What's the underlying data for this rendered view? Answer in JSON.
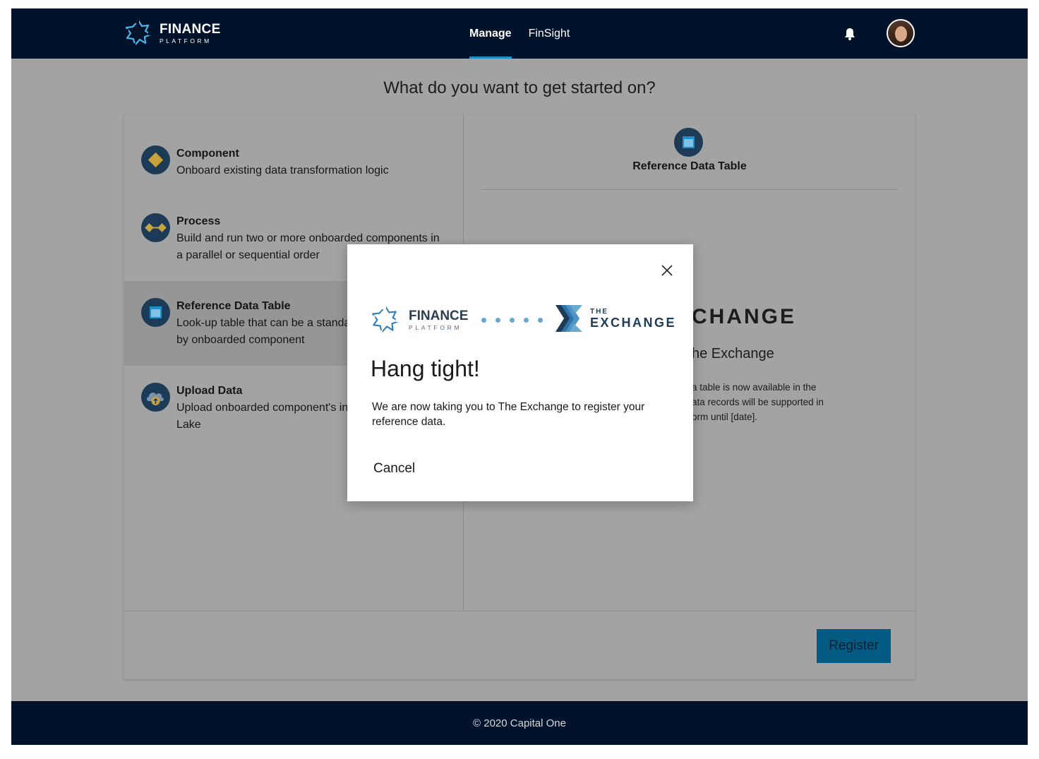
{
  "header": {
    "logo": {
      "name": "FINANCE",
      "sub": "PLATFORM"
    },
    "nav": [
      {
        "label": "Manage",
        "active": true
      },
      {
        "label": "FinSight",
        "active": false
      }
    ],
    "icons": {
      "notifications": "bell-icon",
      "profile": "user-avatar"
    }
  },
  "main": {
    "title": "What do you want to get started on?",
    "options": [
      {
        "title": "Component",
        "description": "Onboard existing data transformation logic",
        "icon": "diamond-icon"
      },
      {
        "title": "Process",
        "description": "Build and run two or more onboarded components in a parallel or sequential order",
        "icon": "process-icon"
      },
      {
        "title": "Reference Data Table",
        "description": "Look-up table that can be a standa",
        "description_line2": "by onboarded component",
        "icon": "table-icon",
        "selected": true
      },
      {
        "title": "Upload Data",
        "description": "Upload onboarded component's in",
        "description_line2": "Lake",
        "icon": "cloud-upload-icon"
      }
    ],
    "detail": {
      "title": "Reference Data Table",
      "brand_partial": "CHANGE",
      "subtitle_partial": "he Exchange",
      "desc_lines": [
        "a table is now available in the",
        "ata records will be supported in",
        "orm until [date]."
      ]
    },
    "register_label": "Register"
  },
  "footer": {
    "copyright": "© 2020 Capital One"
  },
  "modal": {
    "logo_left": {
      "name": "FINANCE",
      "sub": "PLATFORM"
    },
    "logo_right": {
      "the": "THE",
      "name": "EXCHANGE"
    },
    "title": "Hang tight!",
    "body": "We are now taking you to The Exchange to register your reference data.",
    "cancel_label": "Cancel"
  },
  "colors": {
    "nav_bg": "#01132b",
    "accent": "#1f8fc9",
    "overlay": "#a3a3a3",
    "primary_button": "#035b83",
    "icon_gold": "#c8a23a"
  }
}
